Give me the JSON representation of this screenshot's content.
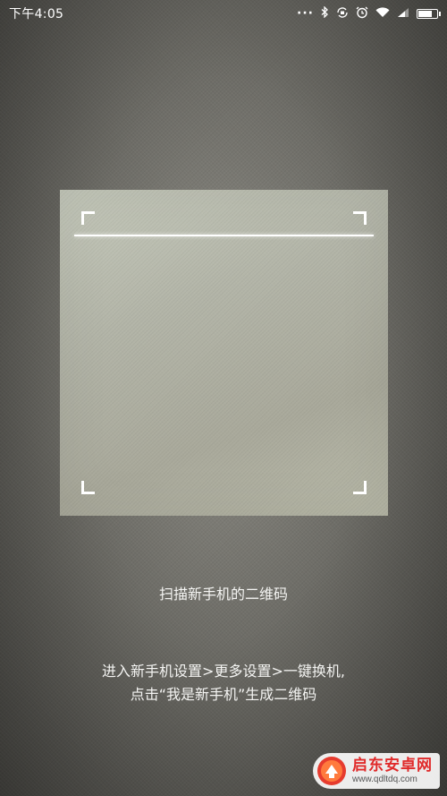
{
  "status_bar": {
    "time": "下午4:05",
    "icons": [
      "more-dots-icon",
      "bluetooth-icon",
      "rotation-lock-icon",
      "alarm-icon",
      "wifi-icon",
      "signal-icon",
      "battery-icon"
    ],
    "battery_level": 0.8
  },
  "scanner": {
    "title": "扫描新手机的二维码",
    "instruction_line1": "进入新手机设置>更多设置>一键换机,",
    "instruction_line2": "点击“我是新手机”生成二维码"
  },
  "watermark": {
    "name": "启东安卓网",
    "url": "www.qdltdq.com"
  }
}
